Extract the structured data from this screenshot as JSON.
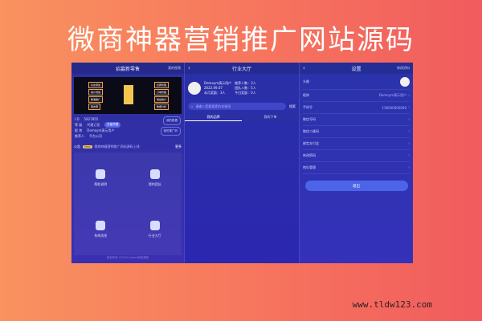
{
  "banner": {
    "title": "微商神器营销推广网站源码"
  },
  "panel1": {
    "header": {
      "title": "招募新零售",
      "right": "我的视频"
    },
    "hero": {
      "chips": [
        "好友添加",
        "客户营销",
        "精准推广",
        "朋友圈",
        "社群管理",
        "订单管理",
        "收益统计",
        "数据分析"
      ],
      "core_label": "微商"
    },
    "info": {
      "rows": [
        {
          "label": "I D",
          "value": "5827855"
        },
        {
          "label": "等 级",
          "value": "代理订货",
          "pill": "升级代理"
        },
        {
          "label": "昵 称",
          "value": "Demoym演示用户"
        },
        {
          "label": "推荐人",
          "value": "平台公司"
        }
      ],
      "side_buttons": [
        "我的数据",
        "我的推广码"
      ]
    },
    "notice": {
      "label": "公告",
      "tag": "New",
      "text": "微商神器营销推广网站源码上线",
      "more": "更多"
    },
    "grid": [
      "帮助说明",
      "我的团队",
      "系统消息",
      "行业大厅"
    ],
    "footer": "版权所有 ©2024 demo网站源码"
  },
  "panel2": {
    "header": {
      "title": "行业大厅"
    },
    "card": {
      "name": "Demoym演示用户",
      "sub": "2022.09.07",
      "stats": [
        "推荐人数：3人",
        "团队人数：5人"
      ],
      "stats2": [
        "本月奖励：3人",
        "今日奖励：0人"
      ]
    },
    "search": {
      "placeholder": "请输入您要搜索的关键词",
      "button": "搜索"
    },
    "tabs": [
      "我的品牌",
      "我的下单"
    ]
  },
  "panel3": {
    "header": {
      "title": "设置",
      "right": "修改资料"
    },
    "rows": [
      {
        "label": "头像",
        "value": ""
      },
      {
        "label": "昵称",
        "value": "Demoym演示用户"
      },
      {
        "label": "手机号",
        "value": "138000000000"
      },
      {
        "label": "微信号码",
        "value": ""
      },
      {
        "label": "微信二维码",
        "value": ""
      },
      {
        "label": "绑定支付宝",
        "value": ""
      },
      {
        "label": "修改密码",
        "value": ""
      },
      {
        "label": "地址管理",
        "value": ""
      }
    ],
    "logout": "退出"
  },
  "watermark": "www.tldw123.com",
  "colors": {
    "accent": "#4c64e8",
    "bg_start": "#f9925f",
    "bg_end": "#f15b5e"
  }
}
